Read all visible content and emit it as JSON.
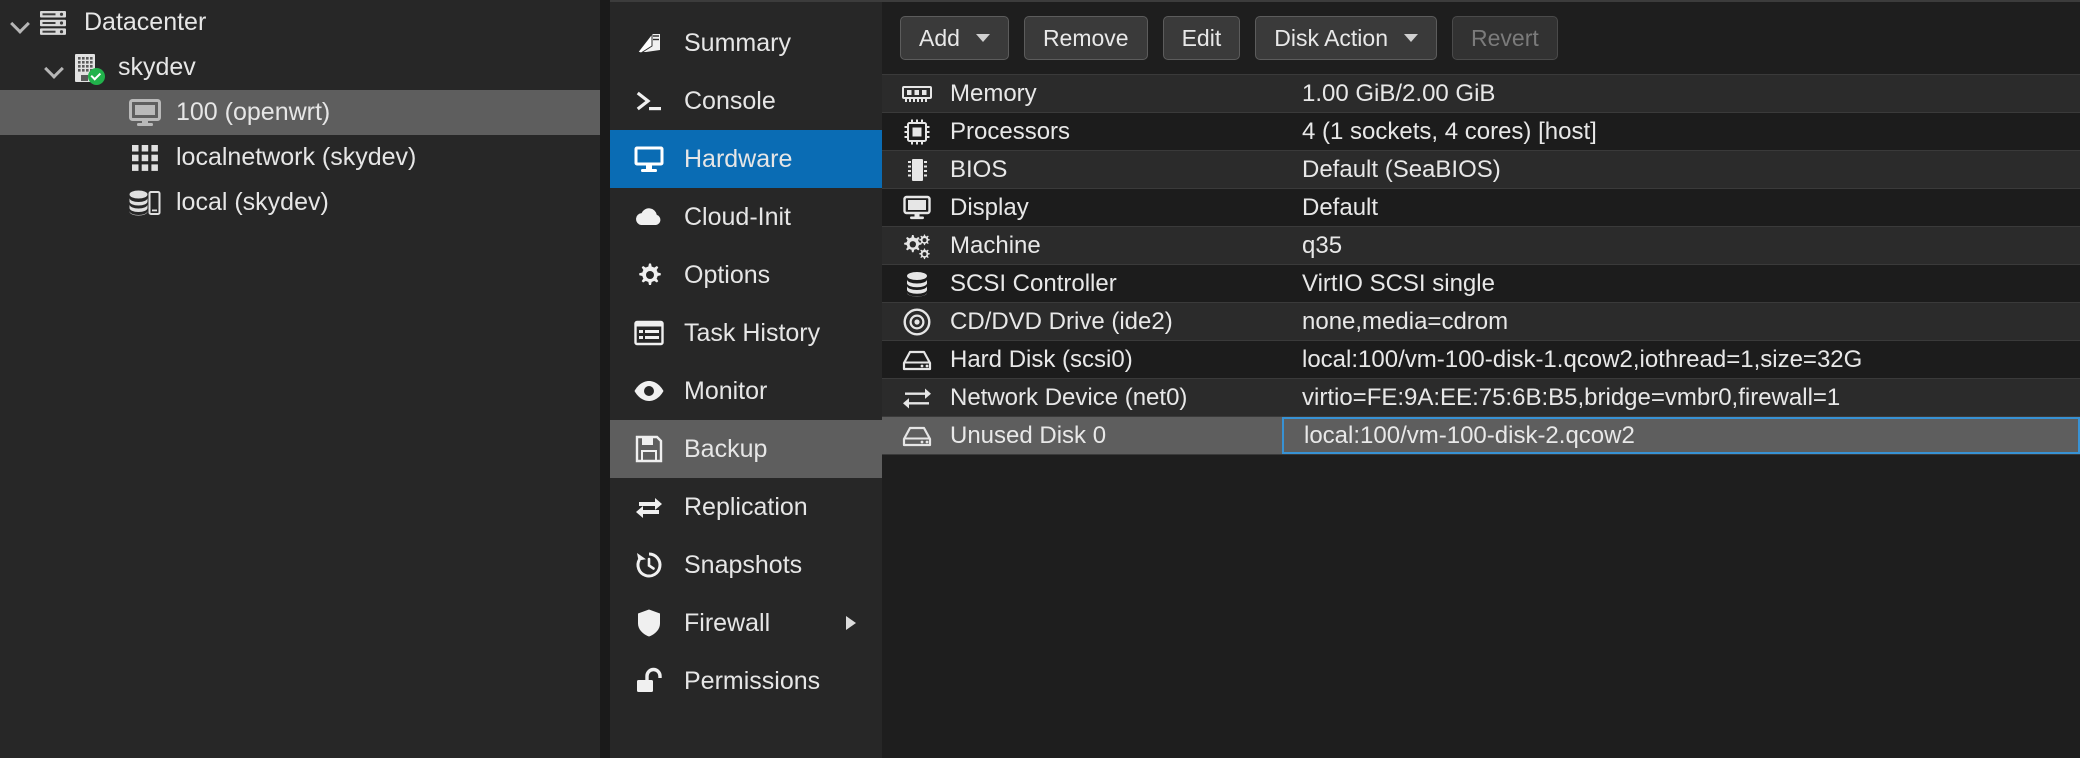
{
  "tree": {
    "items": [
      {
        "label": "Datacenter",
        "icon": "datacenter-icon",
        "depth": 0,
        "expanded": true,
        "selected": false
      },
      {
        "label": "skydev",
        "icon": "node-icon",
        "depth": 1,
        "expanded": true,
        "selected": false,
        "status": "online"
      },
      {
        "label": "100 (openwrt)",
        "icon": "vm-icon",
        "depth": 2,
        "expanded": false,
        "selected": true
      },
      {
        "label": "localnetwork (skydev)",
        "icon": "network-icon",
        "depth": 2,
        "expanded": false,
        "selected": false
      },
      {
        "label": "local (skydev)",
        "icon": "storage-icon",
        "depth": 2,
        "expanded": false,
        "selected": false
      }
    ]
  },
  "nav": {
    "items": [
      {
        "label": "Summary",
        "icon": "book-icon",
        "state": "normal"
      },
      {
        "label": "Console",
        "icon": "terminal-icon",
        "state": "normal"
      },
      {
        "label": "Hardware",
        "icon": "monitor-icon",
        "state": "active"
      },
      {
        "label": "Cloud-Init",
        "icon": "cloud-icon",
        "state": "normal"
      },
      {
        "label": "Options",
        "icon": "gear-icon",
        "state": "normal"
      },
      {
        "label": "Task History",
        "icon": "list-icon",
        "state": "normal"
      },
      {
        "label": "Monitor",
        "icon": "eye-icon",
        "state": "normal"
      },
      {
        "label": "Backup",
        "icon": "floppy-icon",
        "state": "highlight"
      },
      {
        "label": "Replication",
        "icon": "replication-icon",
        "state": "normal"
      },
      {
        "label": "Snapshots",
        "icon": "history-icon",
        "state": "normal"
      },
      {
        "label": "Firewall",
        "icon": "shield-icon",
        "state": "normal",
        "submenu": true
      },
      {
        "label": "Permissions",
        "icon": "unlock-icon",
        "state": "normal"
      }
    ]
  },
  "toolbar": {
    "add_label": "Add",
    "remove_label": "Remove",
    "edit_label": "Edit",
    "disk_action_label": "Disk Action",
    "revert_label": "Revert"
  },
  "hardware": {
    "rows": [
      {
        "icon": "memory-icon",
        "name": "Memory",
        "value": "1.00 GiB/2.00 GiB",
        "selected": false
      },
      {
        "icon": "cpu-icon",
        "name": "Processors",
        "value": "4 (1 sockets, 4 cores) [host]",
        "selected": false
      },
      {
        "icon": "bios-icon",
        "name": "BIOS",
        "value": "Default (SeaBIOS)",
        "selected": false
      },
      {
        "icon": "display-icon",
        "name": "Display",
        "value": "Default",
        "selected": false
      },
      {
        "icon": "machine-icon",
        "name": "Machine",
        "value": "q35",
        "selected": false
      },
      {
        "icon": "scsi-icon",
        "name": "SCSI Controller",
        "value": "VirtIO SCSI single",
        "selected": false
      },
      {
        "icon": "cdrom-icon",
        "name": "CD/DVD Drive (ide2)",
        "value": "none,media=cdrom",
        "selected": false
      },
      {
        "icon": "harddisk-icon",
        "name": "Hard Disk (scsi0)",
        "value": "local:100/vm-100-disk-1.qcow2,iothread=1,size=32G",
        "selected": false
      },
      {
        "icon": "network-device-icon",
        "name": "Network Device (net0)",
        "value": "virtio=FE:9A:EE:75:6B:B5,bridge=vmbr0,firewall=1",
        "selected": false
      },
      {
        "icon": "harddisk-icon",
        "name": "Unused Disk 0",
        "value": "local:100/vm-100-disk-2.qcow2",
        "selected": true
      }
    ]
  },
  "colors": {
    "accent": "#0a6cb4",
    "selection": "#5e5e5e",
    "focus_border": "#3892d4",
    "status_ok": "#21b24b",
    "panel_bg": "#272727",
    "content_bg": "#1e1e1e"
  }
}
